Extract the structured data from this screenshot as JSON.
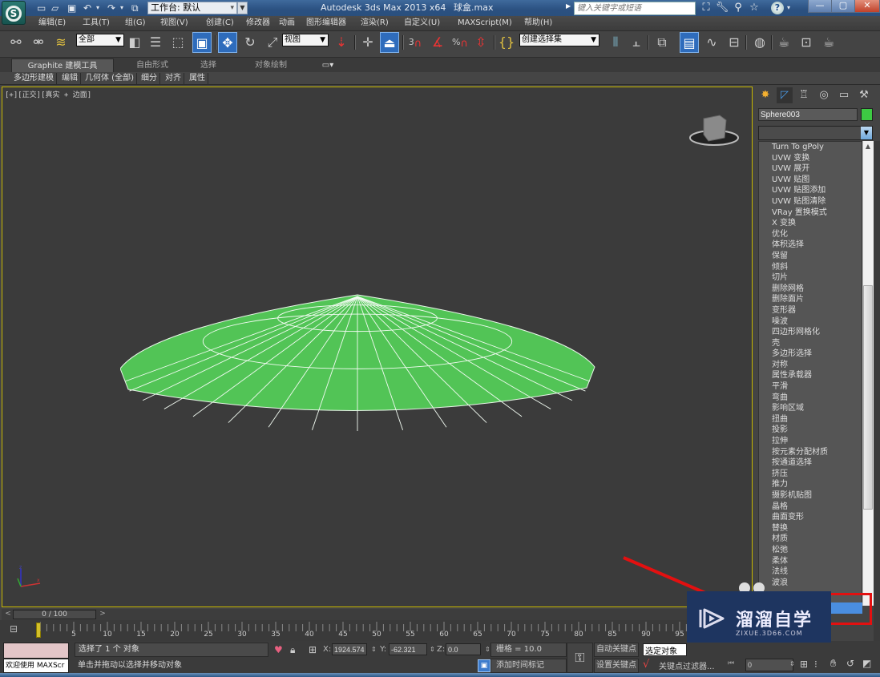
{
  "titlebar": {
    "workspace_label": "工作台: 默认",
    "app_title": "Autodesk 3ds Max  2013 x64",
    "file_name": "球盒.max",
    "search_placeholder": "键入关键字或短语",
    "icons": [
      "new-file-icon",
      "open-file-icon",
      "save-icon",
      "undo-icon",
      "redo-icon",
      "project-folder-icon",
      "binoculars-icon",
      "wrench-icon",
      "satellite-icon",
      "star-icon",
      "help-icon"
    ],
    "window_buttons": {
      "minimize": "—",
      "maximize": "▢",
      "close": "✕"
    }
  },
  "menubar": {
    "items": [
      "编辑(E)",
      "工具(T)",
      "组(G)",
      "视图(V)",
      "创建(C)",
      "修改器",
      "动画",
      "图形编辑器",
      "渲染(R)",
      "自定义(U)",
      "MAXScript(M)",
      "帮助(H)"
    ]
  },
  "toolbar": {
    "selection_filter": "全部",
    "reference_coord": "视图",
    "named_selection": "创建选择集",
    "snap_3": "3",
    "snap_percent": "%"
  },
  "ribbon": {
    "tabs": [
      "Graphite 建模工具",
      "自由形式",
      "选择",
      "对象绘制"
    ],
    "subtabs": [
      "多边形建模",
      "编辑",
      "几何体 (全部)",
      "细分",
      "对齐",
      "属性"
    ]
  },
  "viewport": {
    "label": "[+][正交][真实 + 边面]",
    "object_color": "#52c456"
  },
  "command_panel": {
    "object_name": "Sphere003",
    "object_color": "#3dca43",
    "modifier_list": [
      "Turn To gPoly",
      "UVW 变换",
      "UVW 展开",
      "UVW 贴图",
      "UVW 贴图添加",
      "UVW 贴图清除",
      "VRay 置换模式",
      "X 变换",
      "优化",
      "体积选择",
      "保留",
      "倾斜",
      "切片",
      "删除网格",
      "删除面片",
      "变形器",
      "噪波",
      "四边形网格化",
      "壳",
      "多边形选择",
      "对称",
      "属性承载器",
      "平滑",
      "弯曲",
      "影响区域",
      "扭曲",
      "投影",
      "拉伸",
      "按元素分配材质",
      "按通道选择",
      "挤压",
      "推力",
      "摄影机贴图",
      "晶格",
      "曲面变形",
      "替换",
      "材质",
      "松弛",
      "柔体",
      "法线",
      "波浪"
    ]
  },
  "timeline": {
    "frame_display": "0 / 100",
    "tick_labels": [
      "5",
      "10",
      "15",
      "20",
      "25",
      "30",
      "35",
      "40",
      "45",
      "50",
      "55",
      "60",
      "65",
      "70",
      "75",
      "80",
      "85",
      "90",
      "95"
    ]
  },
  "status": {
    "maxscript_listener": "欢迎使用 MAXScr",
    "selection_status": "选择了 1 个 对象",
    "prompt": "单击并拖动以选择并移动对象",
    "x_label": "X:",
    "x_value": "1924.574",
    "y_label": "Y:",
    "y_value": "-62.321",
    "z_label": "Z:",
    "z_value": "0.0",
    "grid": "栅格 = 10.0",
    "add_time_tag": "添加时间标记",
    "auto_key": "自动关键点",
    "set_key": "设置关键点",
    "selected_object": "选定对象",
    "key_filters": "关键点过滤器...",
    "current_frame": "0"
  },
  "watermark": {
    "title": "溜溜自学",
    "subtitle": "ZIXUE.3D66.COM"
  },
  "annotation": {
    "color": "#e31010"
  }
}
